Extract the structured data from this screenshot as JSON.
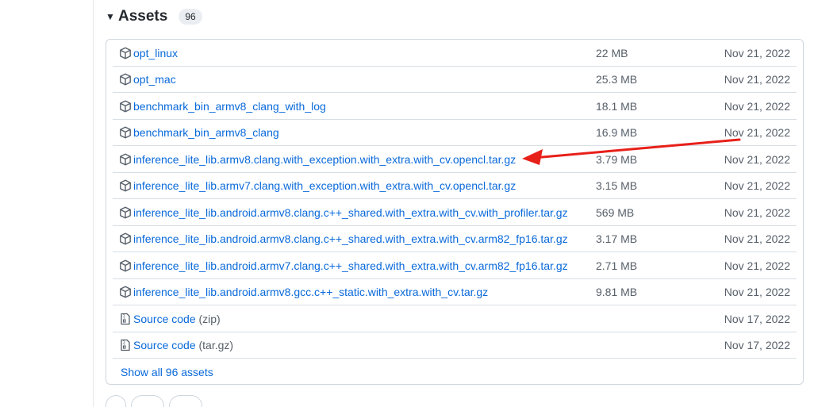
{
  "assets": {
    "title": "Assets",
    "count": "96",
    "show_all_label": "Show all 96 assets",
    "items": [
      {
        "name": "opt_linux",
        "size": "22 MB",
        "date": "Nov 21, 2022",
        "icon": "package-icon"
      },
      {
        "name": "opt_mac",
        "size": "25.3 MB",
        "date": "Nov 21, 2022",
        "icon": "package-icon"
      },
      {
        "name": "benchmark_bin_armv8_clang_with_log",
        "size": "18.1 MB",
        "date": "Nov 21, 2022",
        "icon": "package-icon"
      },
      {
        "name": "benchmark_bin_armv8_clang",
        "size": "16.9 MB",
        "date": "Nov 21, 2022",
        "icon": "package-icon"
      },
      {
        "name": "inference_lite_lib.armv8.clang.with_exception.with_extra.with_cv.opencl.tar.gz",
        "size": "3.79 MB",
        "date": "Nov 21, 2022",
        "icon": "package-icon"
      },
      {
        "name": "inference_lite_lib.armv7.clang.with_exception.with_extra.with_cv.opencl.tar.gz",
        "size": "3.15 MB",
        "date": "Nov 21, 2022",
        "icon": "package-icon"
      },
      {
        "name": "inference_lite_lib.android.armv8.clang.c++_shared.with_extra.with_cv.with_profiler.tar.gz",
        "size": "569 MB",
        "date": "Nov 21, 2022",
        "icon": "package-icon"
      },
      {
        "name": "inference_lite_lib.android.armv8.clang.c++_shared.with_extra.with_cv.arm82_fp16.tar.gz",
        "size": "3.17 MB",
        "date": "Nov 21, 2022",
        "icon": "package-icon"
      },
      {
        "name": "inference_lite_lib.android.armv7.clang.c++_shared.with_extra.with_cv.arm82_fp16.tar.gz",
        "size": "2.71 MB",
        "date": "Nov 21, 2022",
        "icon": "package-icon"
      },
      {
        "name": "inference_lite_lib.android.armv8.gcc.c++_static.with_extra.with_cv.tar.gz",
        "size": "9.81 MB",
        "date": "Nov 21, 2022",
        "icon": "package-icon"
      },
      {
        "name": "Source code",
        "ext": "(zip)",
        "size": "",
        "date": "Nov 17, 2022",
        "icon": "file-zip-icon"
      },
      {
        "name": "Source code",
        "ext": "(tar.gz)",
        "size": "",
        "date": "Nov 17, 2022",
        "icon": "file-zip-icon"
      }
    ]
  },
  "annotation": {
    "color": "#e8201a",
    "icon": "red-arrow"
  },
  "colors": {
    "link": "#0969da",
    "muted": "#57606a",
    "border": "#d0d7de"
  }
}
